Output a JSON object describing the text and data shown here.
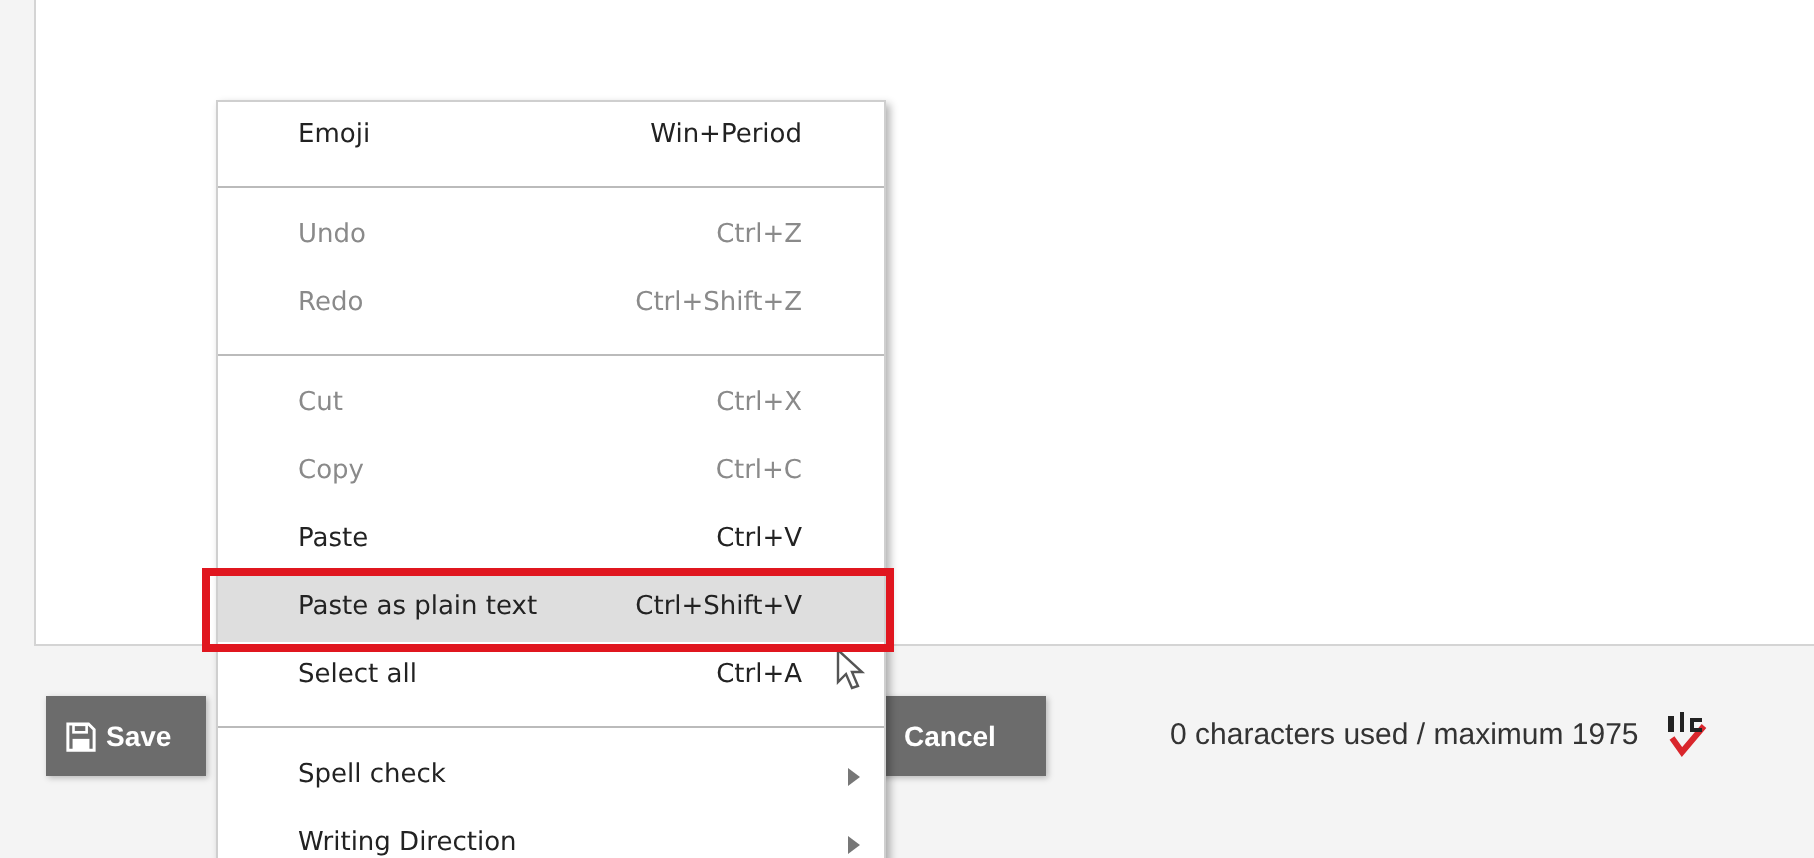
{
  "editor": {
    "buttons": [
      {
        "kind": "save",
        "label": "Save"
      },
      {
        "kind": "cancel",
        "label": "Cancel"
      }
    ],
    "counter": "0 characters used / maximum 1975"
  },
  "context_menu": {
    "groups": [
      [
        {
          "label": "Emoji",
          "shortcut": "Win+Period",
          "disabled": false,
          "selected": false,
          "annotated": false
        }
      ],
      [
        {
          "label": "Undo",
          "shortcut": "Ctrl+Z",
          "disabled": true,
          "selected": false,
          "annotated": false
        },
        {
          "label": "Redo",
          "shortcut": "Ctrl+Shift+Z",
          "disabled": true,
          "selected": false,
          "annotated": false
        }
      ],
      [
        {
          "label": "Cut",
          "shortcut": "Ctrl+X",
          "disabled": true,
          "selected": false,
          "annotated": false
        },
        {
          "label": "Copy",
          "shortcut": "Ctrl+C",
          "disabled": true,
          "selected": false,
          "annotated": false
        },
        {
          "label": "Paste",
          "shortcut": "Ctrl+V",
          "disabled": false,
          "selected": false,
          "annotated": false
        },
        {
          "label": "Paste as plain text",
          "shortcut": "Ctrl+Shift+V",
          "disabled": false,
          "selected": true,
          "annotated": true
        },
        {
          "label": "Select all",
          "shortcut": "Ctrl+A",
          "disabled": false,
          "selected": false,
          "annotated": false
        }
      ],
      [
        {
          "label": "Spell check",
          "submenu": true,
          "disabled": false,
          "selected": false,
          "annotated": false
        },
        {
          "label": "Writing Direction",
          "submenu": true,
          "disabled": false,
          "selected": false,
          "annotated": false
        }
      ]
    ]
  }
}
